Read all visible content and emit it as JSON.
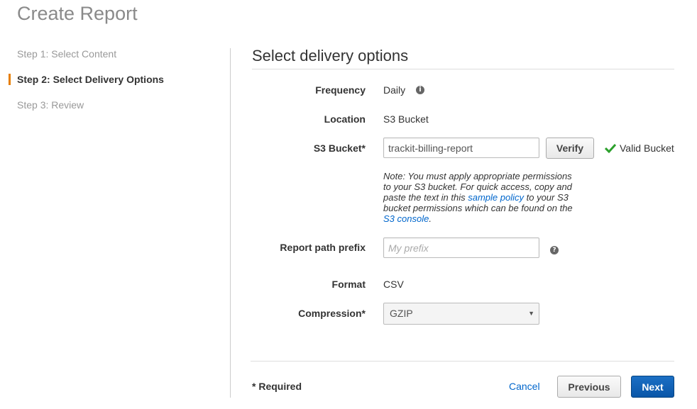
{
  "page": {
    "title": "Create Report"
  },
  "steps": [
    {
      "label": "Step 1: Select Content",
      "active": false
    },
    {
      "label": "Step 2: Select Delivery Options",
      "active": true
    },
    {
      "label": "Step 3: Review",
      "active": false
    }
  ],
  "section": {
    "title": "Select delivery options"
  },
  "fields": {
    "frequency": {
      "label": "Frequency",
      "value": "Daily"
    },
    "location": {
      "label": "Location",
      "value": "S3 Bucket"
    },
    "s3_bucket": {
      "label": "S3 Bucket*",
      "value": "trackit-billing-report",
      "verify_label": "Verify",
      "status": "Valid Bucket",
      "note": {
        "part1": "Note: You must apply appropriate permissions to your S3 bucket. For quick access, copy and paste the text in this ",
        "link1": "sample policy",
        "part2": " to your S3 bucket permissions which can be found on the ",
        "link2": "S3 console",
        "part3": "."
      }
    },
    "report_path_prefix": {
      "label": "Report path prefix",
      "placeholder": "My prefix"
    },
    "format": {
      "label": "Format",
      "value": "CSV"
    },
    "compression": {
      "label": "Compression*",
      "value": "GZIP"
    }
  },
  "footer": {
    "required": "* Required",
    "cancel": "Cancel",
    "previous": "Previous",
    "next": "Next"
  },
  "colors": {
    "accent": "#e67e00",
    "link": "#0066cc",
    "primary": "#0a56a8",
    "valid": "#2ca02c"
  },
  "icons": {
    "info": "info-circle-icon",
    "help": "question-circle-icon",
    "check": "checkmark-icon",
    "caret": "caret-down-icon"
  }
}
